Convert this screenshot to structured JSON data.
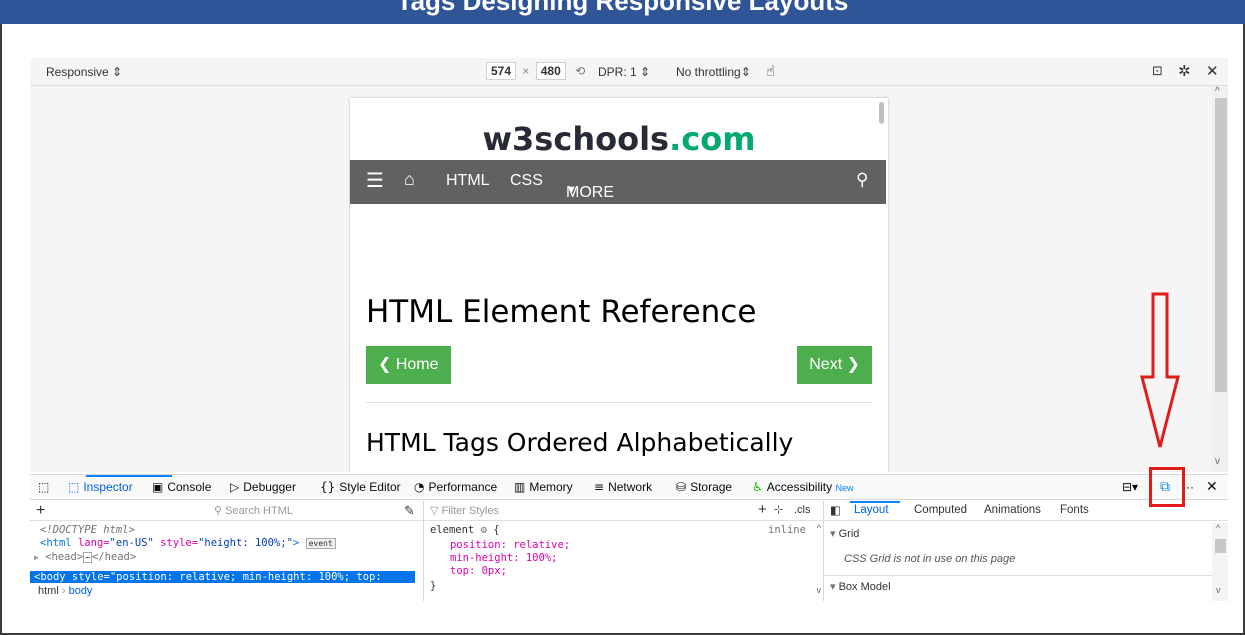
{
  "banner": {
    "title": "Tags Designing Responsive Layouts"
  },
  "rdm": {
    "device": "Responsive",
    "width": "574",
    "times": "×",
    "height": "480",
    "dpr": "DPR: 1",
    "throttling": "No throttling"
  },
  "site": {
    "logo_main": "w3schools",
    "logo_tld": ".com",
    "nav": {
      "html": "HTML",
      "css": "CSS",
      "more": "MORE"
    },
    "title": "HTML Element Reference",
    "home_btn": "❮ Home",
    "next_btn": "Next ❯",
    "subtitle": "HTML Tags Ordered Alphabetically"
  },
  "devtools": {
    "tabs": {
      "inspector": "Inspector",
      "console": "Console",
      "debugger": "Debugger",
      "style_editor": "Style Editor",
      "performance": "Performance",
      "memory": "Memory",
      "network": "Network",
      "storage": "Storage",
      "accessibility": "Accessibility",
      "new_badge": "New"
    },
    "search_placeholder": "Search HTML",
    "filter_placeholder": "Filter Styles",
    "cls": ".cls",
    "right_tabs": {
      "layout": "Layout",
      "computed": "Computed",
      "animations": "Animations",
      "fonts": "Fonts"
    },
    "markup": {
      "doctype": "<!DOCTYPE html>",
      "html_open_tag": "<html",
      "html_attr": "lang=",
      "html_attr_val": "\"en-US\"",
      "html_style": "style=",
      "html_style_val": "\"height: 100%;\"",
      "html_close": ">",
      "event_badge": "event",
      "head": "<head>",
      "head_close": "</head>",
      "body_line": "<body style=\"position: relative; min-height: 100%; top:"
    },
    "breadcrumb": {
      "html": "html",
      "body": "body"
    },
    "rules": {
      "selector": "element",
      "brace_open": "{",
      "inline": "inline",
      "p1": "position: relative;",
      "p2": "min-height: 100%;",
      "p3": "top: 0px;",
      "brace_close": "}"
    },
    "layout": {
      "grid_header": "Grid",
      "grid_msg": "CSS Grid is not in use on this page",
      "box_model_header": "Box Model"
    }
  },
  "colors": {
    "banner": "#2f5597",
    "w3_green": "#04aa6d",
    "button_green": "#4cae4c",
    "nav_grey": "#616161",
    "highlight_red": "#e21b1b",
    "active_tab_blue": "#0060df"
  }
}
